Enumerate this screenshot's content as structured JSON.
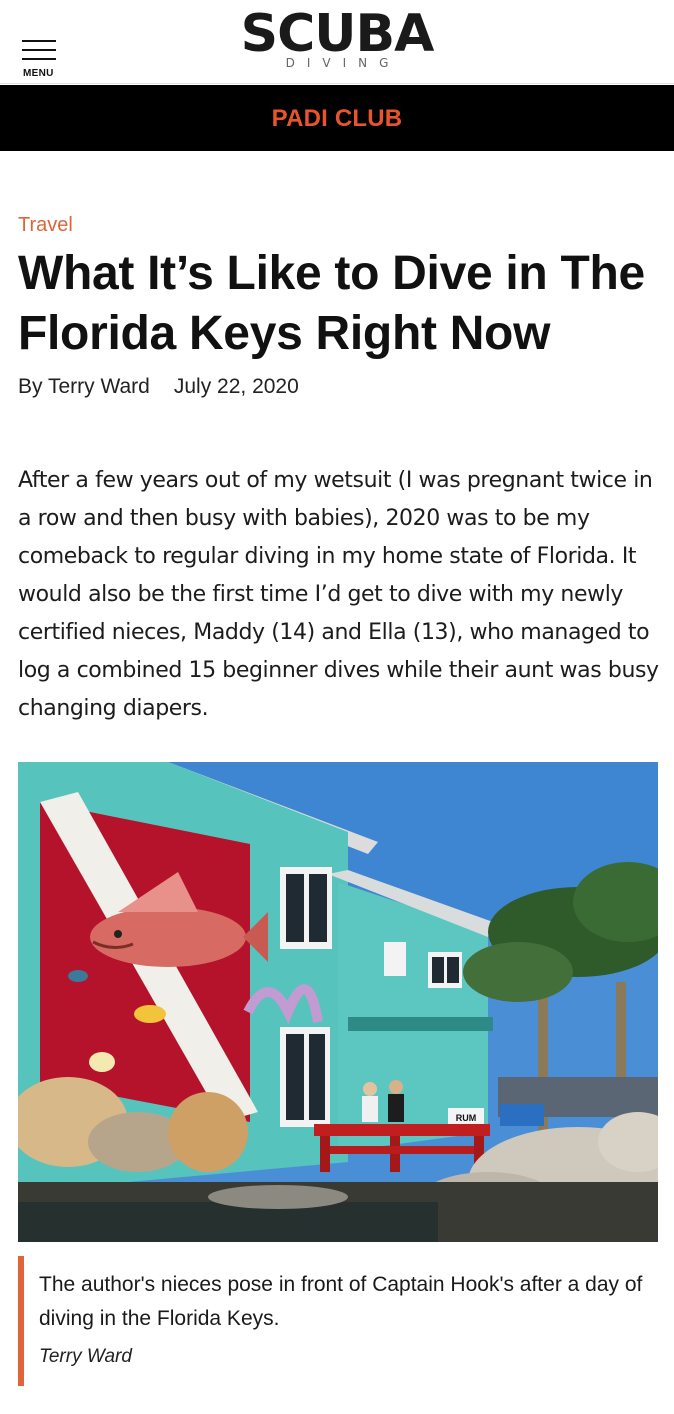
{
  "header": {
    "menu_label": "MENU",
    "logo_main": "SCUBA",
    "logo_sub": "DIVING"
  },
  "banner": {
    "label": "PADI CLUB"
  },
  "article": {
    "category": "Travel",
    "title": "What It’s Like to Dive in The Florida Keys Right Now",
    "author": "By Terry Ward",
    "date": "July 22, 2020",
    "body": "After a few years out of my wetsuit (I was pregnant twice in a row and then busy with babies), 2020 was to be my comeback to regular diving in my home state of Florida. It would also be the first time I’d get to dive with my newly certified nieces, Maddy (14) and Ella (13), who managed to log a combined 15 beginner dives while their aunt was busy changing diapers."
  },
  "photo": {
    "sign_text": "RUM"
  },
  "caption": {
    "text": "The author's nieces pose in front of Captain Hook's after a day of diving in the Florida Keys.",
    "credit": "Terry Ward"
  },
  "colors": {
    "accent": "#e0643a",
    "banner_bg": "#000000",
    "banner_text": "#e8552c",
    "wall_teal": "#57c3bd",
    "flag_red": "#b5132c",
    "sky": "#4a8fd6"
  }
}
